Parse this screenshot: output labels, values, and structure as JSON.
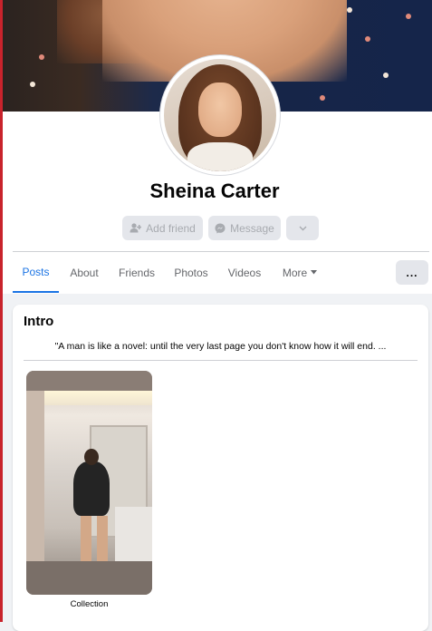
{
  "profile": {
    "name": "Sheina Carter"
  },
  "actions": {
    "add_friend": "Add friend",
    "message": "Message",
    "more_dropdown_icon": "chevron-down-icon"
  },
  "tabs": [
    {
      "label": "Posts",
      "active": true
    },
    {
      "label": "About",
      "active": false
    },
    {
      "label": "Friends",
      "active": false
    },
    {
      "label": "Photos",
      "active": false
    },
    {
      "label": "Videos",
      "active": false
    },
    {
      "label": "More",
      "active": false
    }
  ],
  "overflow_button": "...",
  "intro": {
    "title": "Intro",
    "bio": "\"A man is like a novel: until the very last page you don't know how it will end. ...",
    "featured_label": "Collection"
  },
  "colors": {
    "accent": "#1b74e4",
    "button_bg": "#e4e6eb",
    "disabled_text": "#a8abb0",
    "page_bg": "#f0f2f5"
  }
}
